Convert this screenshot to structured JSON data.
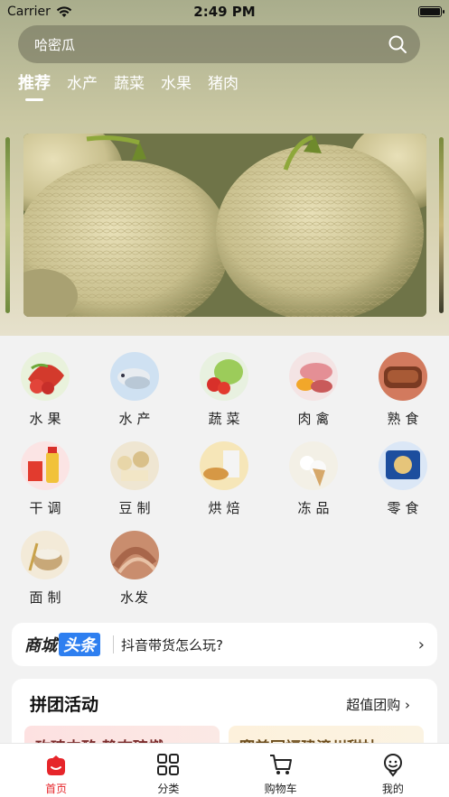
{
  "status": {
    "carrier": "Carrier",
    "time": "2:49 PM"
  },
  "search": {
    "value": "哈密瓜"
  },
  "category_tabs": [
    {
      "label": "推荐",
      "active": true
    },
    {
      "label": "水产",
      "active": false
    },
    {
      "label": "蔬菜",
      "active": false
    },
    {
      "label": "水果",
      "active": false
    },
    {
      "label": "猪肉",
      "active": false
    }
  ],
  "banner": {
    "subject": "hami-melon-photo"
  },
  "grid": [
    {
      "label": "水果",
      "icon": "fruit-icon"
    },
    {
      "label": "水产",
      "icon": "seafood-icon"
    },
    {
      "label": "蔬菜",
      "icon": "vegetable-icon"
    },
    {
      "label": "肉禽",
      "icon": "meat-icon"
    },
    {
      "label": "熟食",
      "icon": "deli-icon"
    },
    {
      "label": "干调",
      "icon": "seasoning-icon"
    },
    {
      "label": "豆制",
      "icon": "bean-icon"
    },
    {
      "label": "烘焙",
      "icon": "bakery-icon"
    },
    {
      "label": "冻品",
      "icon": "frozen-icon"
    },
    {
      "label": "零食",
      "icon": "snack-icon"
    },
    {
      "label": "面制",
      "icon": "flour-icon"
    },
    {
      "label": "水发",
      "icon": "soaked-icon"
    }
  ],
  "headline": {
    "logo_a": "商城",
    "logo_b": "头条",
    "text": "抖音带货怎么玩?"
  },
  "group_buy": {
    "title": "拼团活动",
    "more": "超值团购",
    "cards": [
      {
        "title": "玫瑰内酪 静态碎燃"
      },
      {
        "title": "赛美园福建漳州甜柚"
      }
    ]
  },
  "tabbar": [
    {
      "label": "首页",
      "icon": "home-icon",
      "active": true
    },
    {
      "label": "分类",
      "icon": "category-icon",
      "active": false
    },
    {
      "label": "购物车",
      "icon": "cart-icon",
      "active": false
    },
    {
      "label": "我的",
      "icon": "profile-icon",
      "active": false
    }
  ],
  "colors": {
    "accent": "#e6252a",
    "headline_blue": "#2e7ff0"
  }
}
